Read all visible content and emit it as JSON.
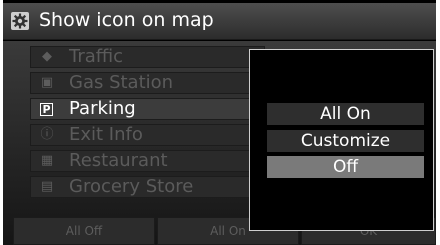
{
  "title": "Show icon on map",
  "menu": [
    {
      "label": "Traffic",
      "icon": "traffic-icon"
    },
    {
      "label": "Gas Station",
      "icon": "gas-station-icon"
    },
    {
      "label": "Parking",
      "icon": "parking-icon",
      "icon_text": "P",
      "active": true
    },
    {
      "label": "Exit Info",
      "icon": "exit-info-icon"
    },
    {
      "label": "Restaurant",
      "icon": "restaurant-icon"
    },
    {
      "label": "Grocery Store",
      "icon": "grocery-store-icon"
    }
  ],
  "bottom_buttons": [
    "All Off",
    "All On",
    "OK"
  ],
  "popup": {
    "options": [
      "All On",
      "Customize",
      "Off"
    ],
    "selected": "Off"
  },
  "colors": {
    "background": "#000000",
    "selected_option": "#7a7a7a",
    "popup_border": "#cfcfcf"
  }
}
